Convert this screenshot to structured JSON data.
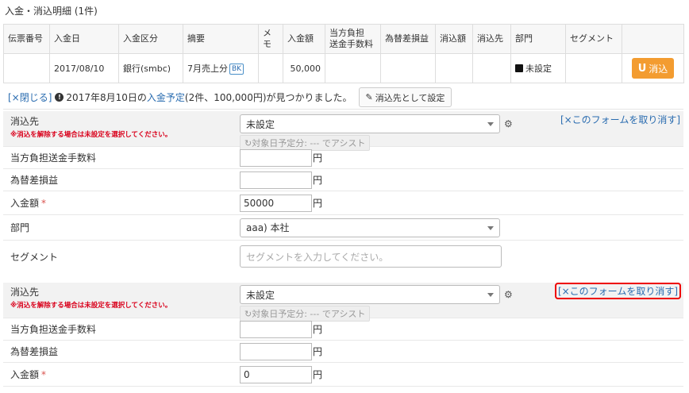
{
  "title": "入金・消込明細 (1件)",
  "table": {
    "headers": [
      "伝票番号",
      "入金日",
      "入金区分",
      "摘要",
      "メモ",
      "入金額",
      "当方負担\n送金手数料",
      "為替差損益",
      "消込額",
      "消込先",
      "部門",
      "セグメント",
      ""
    ],
    "row": {
      "slip_no": "",
      "date": "2017/08/10",
      "category": "銀行(smbc)",
      "summary": "7月売上分",
      "summary_badge": "BK",
      "memo": "",
      "amount": "50,000",
      "fee": "",
      "fx": "",
      "applied": "",
      "applied_to": "",
      "dept": "未設定",
      "segment": "",
      "apply_button": "消込",
      "apply_icon": "U"
    }
  },
  "info": {
    "close": "[×閉じる]",
    "message_pre": "2017年8月10日の",
    "message_link": "入金予定",
    "message_post": "(2件、100,000円)が見つかりました。",
    "set_button": "消込先として設定"
  },
  "form1": {
    "target_label": "消込先",
    "warning": "※消込を解除する場合は未設定を選択してください。",
    "target_value": "未設定",
    "assist": "対象日予定分: --- でアシスト",
    "cancel": "[×このフォームを取り消す]",
    "fee_label": "当方負担送金手数料",
    "fee_value": "",
    "fx_label": "為替差損益",
    "fx_value": "",
    "amount_label": "入金額",
    "required": "*",
    "amount_value": "50000",
    "yen": "円",
    "dept_label": "部門",
    "dept_value": "aaa) 本社",
    "segment_label": "セグメント",
    "segment_placeholder": "セグメントを入力してください。"
  },
  "form2": {
    "target_label": "消込先",
    "warning": "※消込を解除する場合は未設定を選択してください。",
    "target_value": "未設定",
    "assist": "対象日予定分: --- でアシスト",
    "cancel": "[×このフォームを取り消す]",
    "fee_label": "当方負担送金手数料",
    "fee_value": "",
    "fx_label": "為替差損益",
    "fx_value": "",
    "amount_label": "入金額",
    "required": "*",
    "amount_value": "0",
    "yen": "円"
  },
  "colors": {
    "accent": "#2a6cb0",
    "apply_button": "#f39c30",
    "warning": "#d9001b",
    "highlight": "#e00000"
  }
}
